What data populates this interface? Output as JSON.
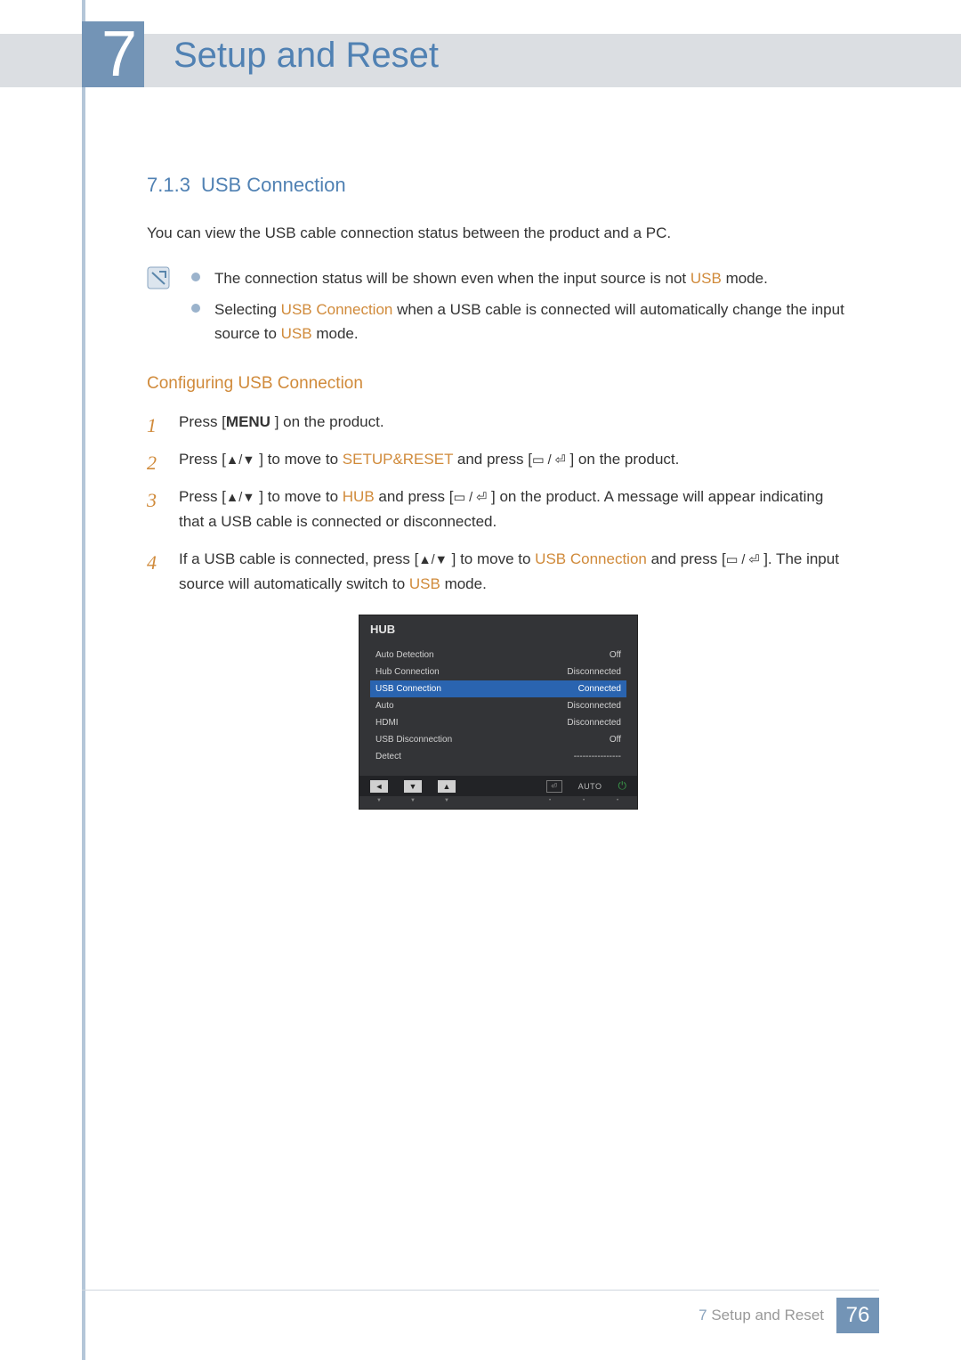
{
  "header": {
    "chapter_number": "7",
    "chapter_title": "Setup and Reset"
  },
  "section": {
    "number": "7.1.3",
    "title": "USB Connection",
    "intro": "You can view the USB cable connection status between the product and a PC.",
    "notes": [
      "The connection status will be shown even when the input source is not ",
      "Selecting "
    ],
    "note1_usb": "USB",
    "note1_tail": " mode.",
    "note2_usbconn": "USB Connection",
    "note2_mid": " when a USB cable is connected will automatically change the input source to ",
    "note2_usb": "USB",
    "note2_tail": " mode."
  },
  "configuring": {
    "title": "Configuring USB Connection",
    "step1a": "Press [",
    "step1_menu": "MENU",
    "step1b": " ] on the product.",
    "step2a": "Press [",
    "step2_arrows": "▲/▼",
    "step2b": " ] to move to ",
    "step2_target": "SETUP&RESET",
    "step2c": " and press [",
    "step2_icons": "▭ / ⏎",
    "step2d": " ] on the product.",
    "step3a": "Press [",
    "step3_arrows": "▲/▼",
    "step3b": " ] to move to ",
    "step3_target": "HUB",
    "step3c": " and press [",
    "step3_icons": "▭ / ⏎",
    "step3d": " ] on the product. A message will appear indicating that a USB cable is connected or disconnected.",
    "step4a": "If a USB cable is connected, press [",
    "step4_arrows": "▲/▼",
    "step4b": " ] to move to ",
    "step4_target": "USB Connection",
    "step4c": " and press [",
    "step4_icons": "▭ / ⏎",
    "step4d": " ]. The input source will automatically switch to ",
    "step4_usb": "USB",
    "step4e": " mode."
  },
  "hub": {
    "title": "HUB",
    "items": [
      {
        "label": "Auto Detection",
        "value": "Off"
      },
      {
        "label": "Hub Connection",
        "value": "Disconnected"
      },
      {
        "label": "USB Connection",
        "value": "Connected"
      },
      {
        "label": "Auto",
        "value": "Disconnected"
      },
      {
        "label": "HDMI",
        "value": "Disconnected"
      },
      {
        "label": "USB Disconnection",
        "value": "Off"
      },
      {
        "label": "Detect",
        "value": "----------------"
      }
    ],
    "auto_label": "AUTO"
  },
  "footer": {
    "chapter_num": "7",
    "chapter_text": " Setup and Reset",
    "page": "76"
  }
}
